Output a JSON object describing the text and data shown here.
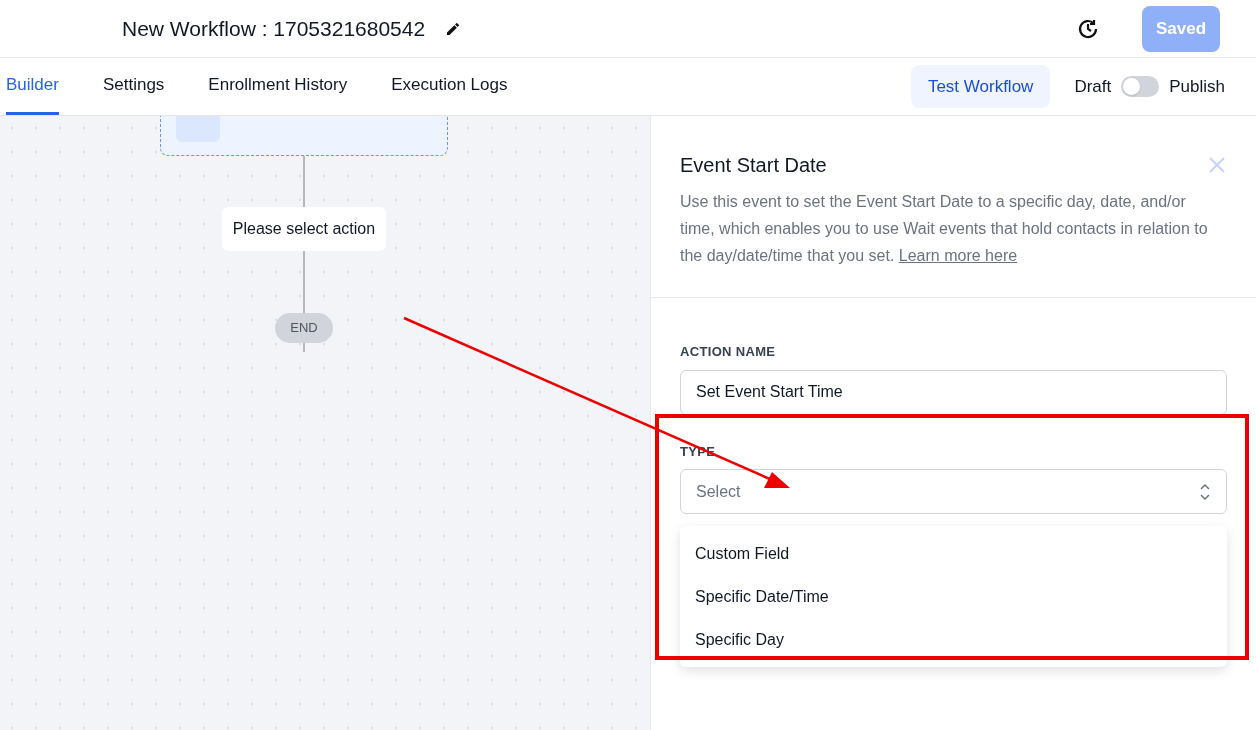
{
  "header": {
    "title": "New Workflow : 1705321680542",
    "save_button": {
      "label": "Saved",
      "disabled": true
    }
  },
  "tabs": [
    {
      "label": "Builder",
      "selected": true
    },
    {
      "label": "Settings",
      "selected": false
    },
    {
      "label": "Enrollment History",
      "selected": false
    },
    {
      "label": "Execution Logs",
      "selected": false
    }
  ],
  "test_button": "Test Workflow",
  "publish_toggle": {
    "off_label": "Draft",
    "on_label": "Publish",
    "on": false
  },
  "canvas": {
    "action_node": "Please select action",
    "end_node": "END"
  },
  "panel": {
    "title": "Event Start Date",
    "description": "Use this event to set the Event Start Date to a specific day, date, and/or time, which enables you to use Wait events that hold contacts in relation to the day/date/time that you set.",
    "link": "Learn more here",
    "fields": [
      {
        "kind": "text",
        "label": "ACTION NAME",
        "value": "Set Event Start Time"
      },
      {
        "kind": "select",
        "label": "TYPE",
        "placeholder": "Select",
        "options": [
          "Custom Field",
          "Specific Date/Time",
          "Specific Day"
        ]
      }
    ]
  }
}
